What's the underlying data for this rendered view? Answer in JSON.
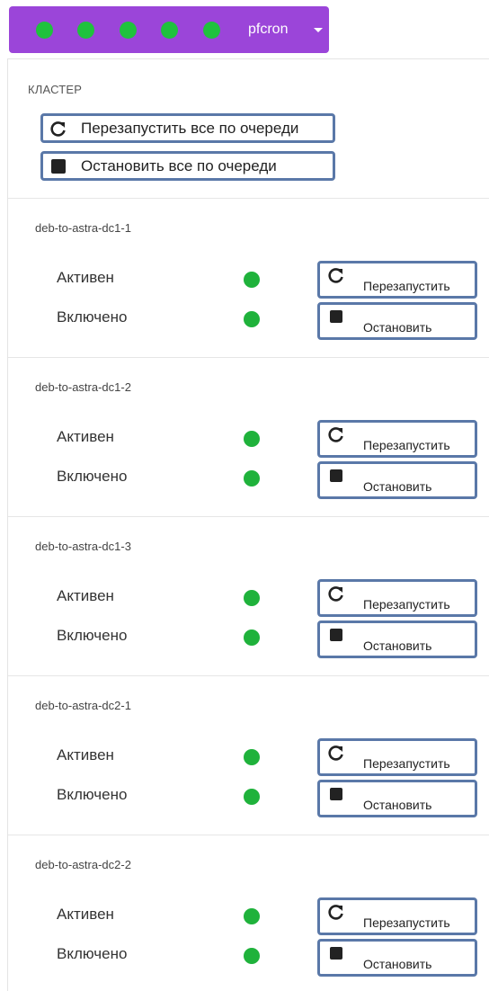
{
  "topbar": {
    "status_dots": [
      "ok",
      "ok",
      "ok",
      "ok",
      "ok"
    ],
    "cluster_name": "pfcron",
    "accent_color": "#9b45d9",
    "ok_color": "#1fc23d"
  },
  "cluster": {
    "title": "КЛАСТЕР",
    "restart_all_label": "Перезапустить все по очереди",
    "stop_all_label": "Остановить все по очереди"
  },
  "labels": {
    "active": "Активен",
    "enabled": "Включено",
    "restart": "Перезапустить",
    "stop": "Остановить"
  },
  "services": [
    {
      "name": "deb-to-astra-dc1-1",
      "active": true,
      "enabled": true
    },
    {
      "name": "deb-to-astra-dc1-2",
      "active": true,
      "enabled": true
    },
    {
      "name": "deb-to-astra-dc1-3",
      "active": true,
      "enabled": true
    },
    {
      "name": "deb-to-astra-dc2-1",
      "active": true,
      "enabled": true
    },
    {
      "name": "deb-to-astra-dc2-2",
      "active": true,
      "enabled": true
    }
  ]
}
